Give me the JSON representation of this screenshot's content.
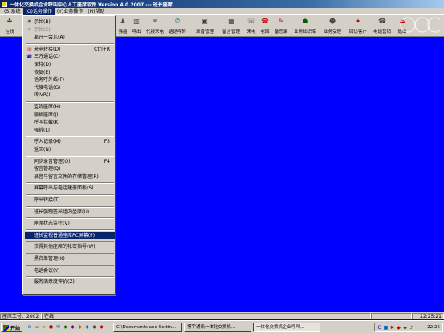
{
  "window": {
    "title": "一体化交换机企业呼叫中心人工座席软件 Version 4.0.2007 --- 班长座席"
  },
  "menubar": [
    {
      "label": "(S)系统",
      "active": false
    },
    {
      "label": "(O)话务操作",
      "active": true
    },
    {
      "label": "(Y)业务操作",
      "active": false
    },
    {
      "label": "(H)帮助",
      "active": false
    }
  ],
  "toolbar": {
    "left": {
      "label": "在线",
      "icon": "agent-icon"
    },
    "buttons": [
      {
        "label": "强插",
        "icon": "barge-in-icon"
      },
      {
        "label": "呼出",
        "icon": "dial-out-icon"
      },
      {
        "label": "代接来电",
        "icon": "pickup-icon"
      },
      {
        "label": "话话呼转",
        "icon": "forward-icon"
      },
      {
        "label": "录音管理",
        "icon": "recording-icon"
      },
      {
        "label": "留言管理",
        "icon": "message-icon"
      },
      {
        "label": "来电",
        "icon": "incoming-icon"
      },
      {
        "label": "老回",
        "icon": "callback-icon"
      },
      {
        "label": "备忘录",
        "icon": "memo-icon"
      },
      {
        "label": "业务知识库",
        "icon": "knowledge-icon"
      },
      {
        "label": "业务受理",
        "icon": "business-icon"
      },
      {
        "label": "回访客户",
        "icon": "revisit-icon"
      },
      {
        "label": "电话营销",
        "icon": "telemarketing-icon"
      },
      {
        "label": "退出",
        "icon": "exit-icon"
      }
    ]
  },
  "dropdown": {
    "items": [
      {
        "type": "item",
        "label": "示忙(B)",
        "shortcut": "",
        "disabled": false,
        "icon": "busy-icon"
      },
      {
        "type": "item",
        "label": "示忙(C)",
        "shortcut": "",
        "disabled": true,
        "icon": "idle-icon"
      },
      {
        "type": "item",
        "label": "离开一会儿(A)",
        "shortcut": "",
        "disabled": false,
        "icon": ""
      },
      {
        "type": "sep"
      },
      {
        "type": "item",
        "label": "来电转接(D)",
        "shortcut": "Ctrl+R",
        "disabled": false,
        "icon": "transfer-icon"
      },
      {
        "type": "item",
        "label": "三方通话(C)",
        "shortcut": "",
        "disabled": false,
        "icon": "conference-icon"
      },
      {
        "type": "item",
        "label": "保持(D)",
        "shortcut": "",
        "disabled": false,
        "icon": ""
      },
      {
        "type": "item",
        "label": "恢复(E)",
        "shortcut": "",
        "disabled": false,
        "icon": ""
      },
      {
        "type": "item",
        "label": "话务呼外线(F)",
        "shortcut": "",
        "disabled": false,
        "icon": ""
      },
      {
        "type": "item",
        "label": "代接电话(G)",
        "shortcut": "",
        "disabled": false,
        "icon": ""
      },
      {
        "type": "item",
        "label": "转IVR(I)",
        "shortcut": "",
        "disabled": false,
        "icon": ""
      },
      {
        "type": "sep"
      },
      {
        "type": "item",
        "label": "监听座席(H)",
        "shortcut": "",
        "disabled": false,
        "icon": ""
      },
      {
        "type": "item",
        "label": "强插座席(J)",
        "shortcut": "",
        "disabled": false,
        "icon": ""
      },
      {
        "type": "item",
        "label": "呼叫拦截(K)",
        "shortcut": "",
        "disabled": false,
        "icon": ""
      },
      {
        "type": "item",
        "label": "强拆(L)",
        "shortcut": "",
        "disabled": false,
        "icon": ""
      },
      {
        "type": "sep"
      },
      {
        "type": "item",
        "label": "呼入记录(M)",
        "shortcut": "F3",
        "disabled": false,
        "icon": ""
      },
      {
        "type": "item",
        "label": "返回(N)",
        "shortcut": "",
        "disabled": false,
        "icon": ""
      },
      {
        "type": "sep"
      },
      {
        "type": "item",
        "label": "同步录音管理(O)",
        "shortcut": "F4",
        "disabled": false,
        "icon": ""
      },
      {
        "type": "item",
        "label": "留言管理(Q)",
        "shortcut": "",
        "disabled": false,
        "icon": ""
      },
      {
        "type": "item",
        "label": "录音与留言文件的存储管理(R)",
        "shortcut": "",
        "disabled": false,
        "icon": ""
      },
      {
        "type": "sep"
      },
      {
        "type": "item",
        "label": "屏幕呼出与电话建册面板(S)",
        "shortcut": "",
        "disabled": false,
        "icon": ""
      },
      {
        "type": "sep"
      },
      {
        "type": "item",
        "label": "呼出转接(T)",
        "shortcut": "",
        "disabled": false,
        "icon": ""
      },
      {
        "type": "sep"
      },
      {
        "type": "item",
        "label": "班长强制签出组内坐席(U)",
        "shortcut": "",
        "disabled": false,
        "icon": ""
      },
      {
        "type": "sep"
      },
      {
        "type": "item",
        "label": "座席状态监控(V)",
        "shortcut": "",
        "disabled": false,
        "icon": ""
      },
      {
        "type": "sep"
      },
      {
        "type": "item",
        "label": "班长监视普通座席PC屏幕(P)",
        "shortcut": "",
        "disabled": false,
        "icon": "",
        "highlighted": true
      },
      {
        "type": "sep"
      },
      {
        "type": "item",
        "label": "获得其他座席的帐密指导(W)",
        "shortcut": "",
        "disabled": false,
        "icon": ""
      },
      {
        "type": "sep"
      },
      {
        "type": "item",
        "label": "黑名单管理(X)",
        "shortcut": "",
        "disabled": false,
        "icon": ""
      },
      {
        "type": "sep"
      },
      {
        "type": "item",
        "label": "电话会议(Y)",
        "shortcut": "",
        "disabled": false,
        "icon": ""
      },
      {
        "type": "sep"
      },
      {
        "type": "item",
        "label": "服务满意度评价(Z)",
        "shortcut": "",
        "disabled": false,
        "icon": ""
      }
    ]
  },
  "statusbar": {
    "agent_id": "座席工号：2002",
    "status": "在线",
    "time": "22:25:21"
  },
  "taskbar": {
    "start_label": "开始",
    "tasks": [
      {
        "label": "C:\\Documents and Settin...",
        "active": false
      },
      {
        "label": "博宇通讯一体化交换机...",
        "active": false
      },
      {
        "label": "一体化交换机企业呼叫...",
        "active": true
      }
    ],
    "clock": "22:25"
  },
  "colors": {
    "desktop": "#0000ff",
    "highlight": "#0a246a",
    "face": "#d4d0c8"
  }
}
